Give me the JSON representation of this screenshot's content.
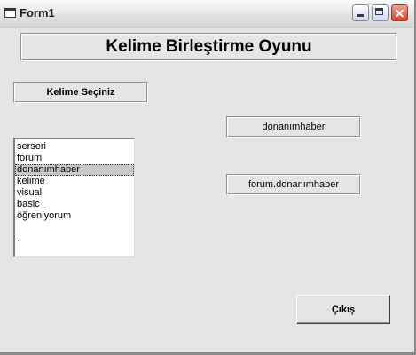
{
  "window": {
    "title": "Form1"
  },
  "heading": "Kelime Birleştirme Oyunu",
  "select_label": "Kelime Seçiniz",
  "list": {
    "items": [
      "serseri",
      "forum",
      "donanımhaber",
      "kelime",
      "visual",
      "basic",
      "öğreniyorum",
      "",
      "."
    ],
    "selected_index": 2
  },
  "results": {
    "selected_word": "donanımhaber",
    "combined": "forum.donanımhaber"
  },
  "buttons": {
    "exit_label": "Çıkış"
  },
  "icons": {
    "app": "form-app-icon",
    "minimize": "minimize-icon",
    "maximize": "maximize-icon",
    "close": "close-icon"
  }
}
